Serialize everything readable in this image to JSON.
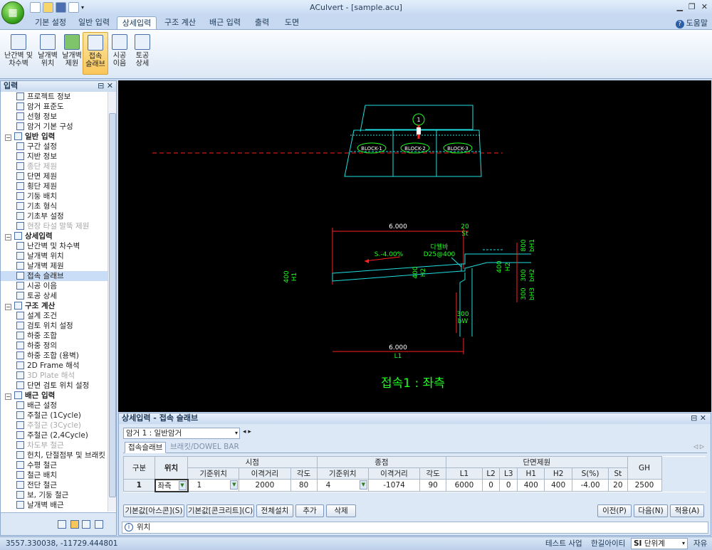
{
  "title": "ACulvert - [sample.acu]",
  "help_label": "도움말",
  "ribbon_tabs": [
    "기본 설정",
    "일반 입력",
    "상세입력",
    "구조 계산",
    "배근 입력",
    "출력",
    "도면"
  ],
  "active_tab": 2,
  "ribbon_buttons": [
    {
      "line1": "난간벽 및",
      "line2": "차수벽"
    },
    {
      "line1": "날개벽",
      "line2": "위치"
    },
    {
      "line1": "날개벽",
      "line2": "제원"
    },
    {
      "line1": "접속",
      "line2": "슬래브"
    },
    {
      "line1": "시공",
      "line2": "이음"
    },
    {
      "line1": "토공",
      "line2": "상세"
    }
  ],
  "left_panel": {
    "title": "입력",
    "pin": "⊟ ✕",
    "items": [
      {
        "label": "프로젝트 정보",
        "type": "item"
      },
      {
        "label": "암거 표준도",
        "type": "item"
      },
      {
        "label": "선형 정보",
        "type": "item"
      },
      {
        "label": "암거 기본 구성",
        "type": "item"
      },
      {
        "label": "일반 입력",
        "type": "group"
      },
      {
        "label": "구간 설정",
        "type": "item"
      },
      {
        "label": "지반 정보",
        "type": "item"
      },
      {
        "label": "종단 제원",
        "type": "disabled"
      },
      {
        "label": "단면 제원",
        "type": "item"
      },
      {
        "label": "횡단 제원",
        "type": "item"
      },
      {
        "label": "기둥 배치",
        "type": "item"
      },
      {
        "label": "기초 형식",
        "type": "item"
      },
      {
        "label": "기초부 설정",
        "type": "item"
      },
      {
        "label": "현장 타설 말뚝 제원",
        "type": "disabled"
      },
      {
        "label": "상세입력",
        "type": "group"
      },
      {
        "label": "난간벽 및 차수벽",
        "type": "item"
      },
      {
        "label": "날개벽 위치",
        "type": "item"
      },
      {
        "label": "날개벽 제원",
        "type": "item"
      },
      {
        "label": "접속 슬래브",
        "type": "selected"
      },
      {
        "label": "시공 이음",
        "type": "item"
      },
      {
        "label": "토공 상세",
        "type": "item"
      },
      {
        "label": "구조 계산",
        "type": "group"
      },
      {
        "label": "설계 조건",
        "type": "item"
      },
      {
        "label": "검토 위치 설정",
        "type": "item"
      },
      {
        "label": "하중 조합",
        "type": "item"
      },
      {
        "label": "하중 정의",
        "type": "item"
      },
      {
        "label": "하중 조합 (용벽)",
        "type": "item"
      },
      {
        "label": "2D Frame 해석",
        "type": "item"
      },
      {
        "label": "3D Plate 해석",
        "type": "disabled"
      },
      {
        "label": "단면 검토 위치 설정",
        "type": "item"
      },
      {
        "label": "배근 입력",
        "type": "group"
      },
      {
        "label": "배근 설정",
        "type": "item"
      },
      {
        "label": "주철근 (1Cycle)",
        "type": "item"
      },
      {
        "label": "주철근 (3Cycle)",
        "type": "disabled"
      },
      {
        "label": "주철근 (2,4Cycle)",
        "type": "item"
      },
      {
        "label": "차도부 철근",
        "type": "disabled"
      },
      {
        "label": "헌치, 단절점부 및 브래킷",
        "type": "item"
      },
      {
        "label": "수평 철근",
        "type": "item"
      },
      {
        "label": "철근 배치",
        "type": "item"
      },
      {
        "label": "전단 철근",
        "type": "item"
      },
      {
        "label": "보, 기둥 철근",
        "type": "item"
      },
      {
        "label": "날개벽 배근",
        "type": "item"
      }
    ]
  },
  "drawing": {
    "blocks": [
      "BLOCK-1",
      "BLOCK-2",
      "BLOCK-3"
    ],
    "marker": "1",
    "dim_top": "6.000",
    "dim_top_right": "20",
    "dim_top_right2": "St",
    "slope": "S.-4.00%",
    "dowel1": "다웰바",
    "dowel2": "D25@400",
    "h1_left": "400",
    "h1_left2": "H1",
    "mid_a": "400",
    "mid_b": "H2",
    "h2_v": "400",
    "h2_v2": "H2",
    "bh1a": "800",
    "bh1b": "bH1",
    "bh2a": "300",
    "bh2b": "bH2",
    "bh3a": "300",
    "bh3b": "bH3",
    "bw1": "300",
    "bw2": "bW",
    "dim_bot": "6.000",
    "dim_bot2": "L1",
    "caption": "접속1 : 좌측"
  },
  "bottom_panel": {
    "title": "상세입력 - 접속 슬래브",
    "pin": "⊟ ✕",
    "combo": "암거 1 : 일반암거",
    "nav_prev": "◂",
    "nav_next": "▸",
    "subtabs": [
      "접속슬래브",
      "브래킷/DOWEL BAR"
    ],
    "tab_pager": "◁ ▷",
    "headers": {
      "gubun": "구분",
      "pos": "위치",
      "start": "시점",
      "end": "종점",
      "section": "단면제원",
      "gh": "GH",
      "start_cols": [
        "기준위치",
        "이격거리",
        "각도"
      ],
      "end_cols": [
        "기준위치",
        "이격거리",
        "각도"
      ],
      "section_cols": [
        "L1",
        "L2",
        "L3",
        "H1",
        "H2",
        "S(%)",
        "St"
      ]
    },
    "row": {
      "no": "1",
      "pos": "좌측",
      "start_ref": "1",
      "start_dist": "2000",
      "start_ang": "80",
      "end_ref": "4",
      "end_dist": "-1074",
      "end_ang": "90",
      "L1": "6000",
      "L2": "0",
      "L3": "0",
      "H1": "400",
      "H2": "400",
      "S": "-4.00",
      "St": "20",
      "GH": "2500"
    },
    "buttons": [
      "기본값[아스콘](S)",
      "기본값[콘크리트](C)",
      "전체설치",
      "추가",
      "삭제",
      "이전(P)",
      "다음(N)",
      "적용(A)"
    ],
    "info": "위치"
  },
  "status": {
    "coords": "3557.330038, -11729.444801",
    "project": "테스트 사업",
    "company": "한길아이티",
    "unit_prefix": "SI",
    "unit": "단위계",
    "mode": "자유"
  }
}
